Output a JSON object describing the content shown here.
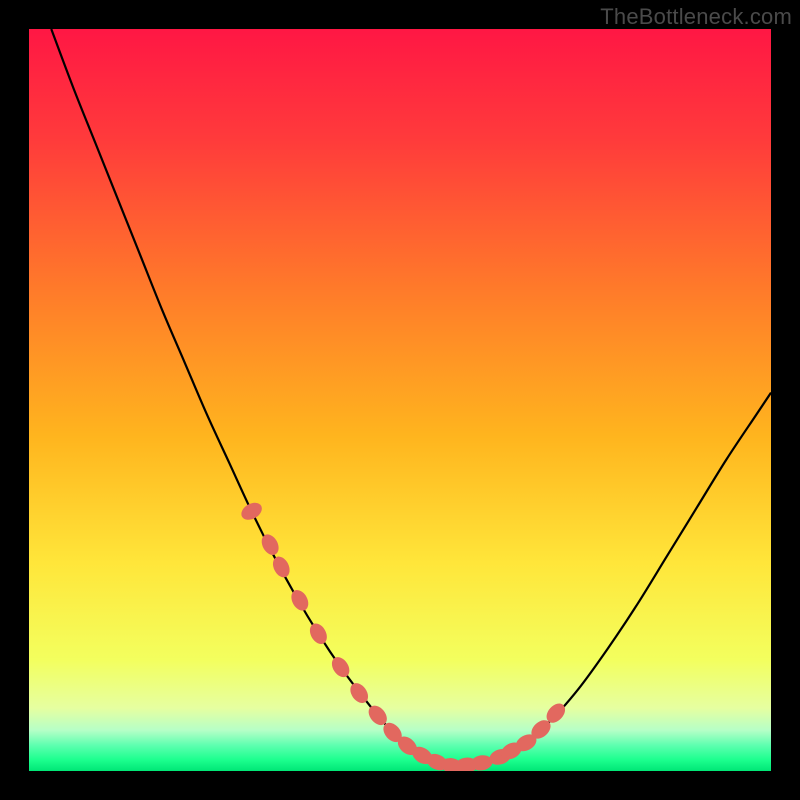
{
  "watermark": "TheBottleneck.com",
  "colors": {
    "bg": "#000000",
    "curve": "#000000",
    "marker_fill": "#e2685f",
    "marker_stroke": "#d94f45",
    "gradient_stops": [
      {
        "offset": 0.0,
        "color": "#ff1744"
      },
      {
        "offset": 0.15,
        "color": "#ff3b3b"
      },
      {
        "offset": 0.35,
        "color": "#ff7a2a"
      },
      {
        "offset": 0.55,
        "color": "#ffb51e"
      },
      {
        "offset": 0.72,
        "color": "#ffe63a"
      },
      {
        "offset": 0.85,
        "color": "#f3ff5e"
      },
      {
        "offset": 0.915,
        "color": "#e6ffa0"
      },
      {
        "offset": 0.945,
        "color": "#b6ffc7"
      },
      {
        "offset": 0.965,
        "color": "#5fffb0"
      },
      {
        "offset": 0.985,
        "color": "#1cff8e"
      },
      {
        "offset": 1.0,
        "color": "#00e676"
      }
    ]
  },
  "chart_data": {
    "type": "line",
    "title": "",
    "xlabel": "",
    "ylabel": "",
    "xlim": [
      0,
      100
    ],
    "ylim": [
      0,
      100
    ],
    "series": [
      {
        "name": "bottleneck-curve",
        "x": [
          3,
          6,
          9,
          12,
          15,
          18,
          21,
          24,
          27,
          30,
          33,
          36,
          39,
          42,
          45,
          47,
          49,
          51,
          53,
          55,
          57,
          60,
          63,
          66,
          70,
          74,
          78,
          82,
          86,
          90,
          94,
          98,
          100
        ],
        "y": [
          100,
          92,
          84.5,
          77,
          69.5,
          62,
          55,
          48,
          41.5,
          35,
          29,
          23.5,
          18.5,
          14,
          10,
          7.5,
          5.2,
          3.4,
          2.1,
          1.2,
          0.7,
          0.9,
          1.6,
          3.2,
          6.5,
          11,
          16.5,
          22.5,
          29,
          35.5,
          42,
          48,
          51
        ]
      }
    ],
    "markers": {
      "name": "highlight-points",
      "x": [
        30,
        32.5,
        34,
        36.5,
        39,
        42,
        44.5,
        47,
        49,
        51,
        53,
        55,
        57,
        59,
        61,
        63.5,
        65,
        67,
        69,
        71
      ],
      "y": [
        35,
        30.5,
        27.5,
        23,
        18.5,
        14,
        10.5,
        7.5,
        5.2,
        3.4,
        2.1,
        1.2,
        0.7,
        0.8,
        1.1,
        1.9,
        2.7,
        3.8,
        5.6,
        7.8
      ]
    }
  }
}
